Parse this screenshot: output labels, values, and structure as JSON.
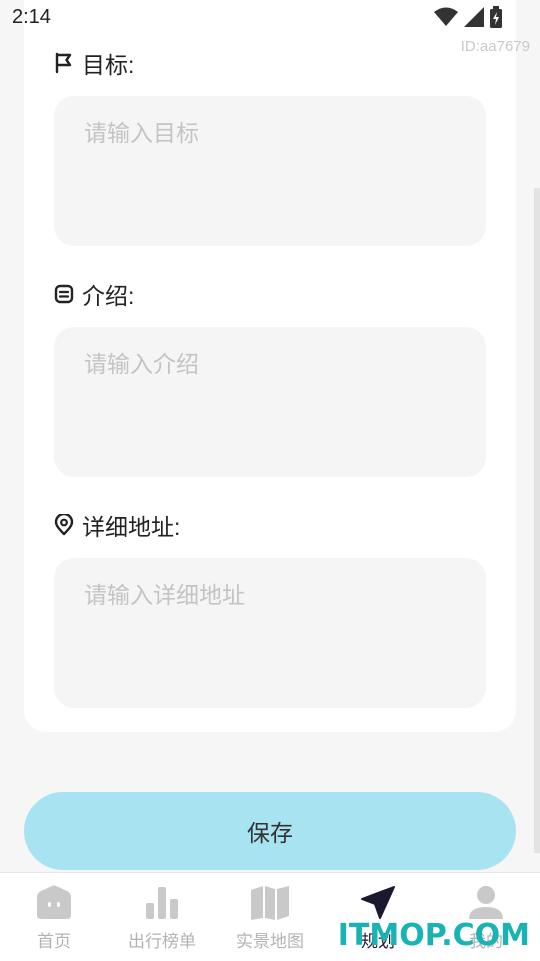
{
  "status_bar": {
    "time": "2:14"
  },
  "watermark_id": "ID:aa7679",
  "form": {
    "goal": {
      "label": "目标:",
      "placeholder": "请输入目标"
    },
    "intro": {
      "label": "介绍:",
      "placeholder": "请输入介绍"
    },
    "address": {
      "label": "详细地址:",
      "placeholder": "请输入详细地址"
    }
  },
  "save_label": "保存",
  "bottom_nav": {
    "items": [
      {
        "label": "首页",
        "icon": "home-icon"
      },
      {
        "label": "出行榜单",
        "icon": "bar-chart-icon"
      },
      {
        "label": "实景地图",
        "icon": "map-icon"
      },
      {
        "label": "规划",
        "icon": "navigation-arrow-icon",
        "active": true
      },
      {
        "label": "我的",
        "icon": "user-icon"
      }
    ]
  },
  "site_watermark": "ITMOP.COM",
  "colors": {
    "accent": "#a8e3f2",
    "active_nav": "#1a1a2e",
    "inactive_nav": "#b3b3b3",
    "watermark": "#19b3b3"
  }
}
